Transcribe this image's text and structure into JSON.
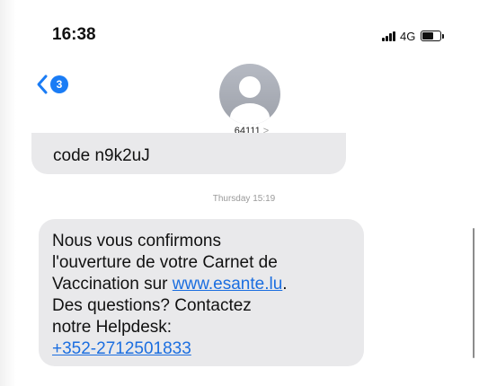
{
  "status_bar": {
    "time": "16:38",
    "network": "4G"
  },
  "header": {
    "back_badge": "3",
    "contact": "64111",
    "contact_chevron": ">"
  },
  "messages": {
    "partial": {
      "text": "code n9k2uJ"
    },
    "timestamp": "Thursday 15:19",
    "confirmation": {
      "line1": "Nous vous confirmons",
      "line2": "l'ouverture de votre Carnet de",
      "line3_prefix": "Vaccination sur ",
      "link_url_text": "www.esante.lu",
      "line3_suffix": ".",
      "line4": "Des questions? Contactez",
      "line5": "notre Helpdesk:",
      "phone_link": "+352-2712501833"
    }
  },
  "colors": {
    "accent": "#1a7cf5",
    "bubble": "#e9e9eb",
    "link": "#1b6ee0"
  }
}
